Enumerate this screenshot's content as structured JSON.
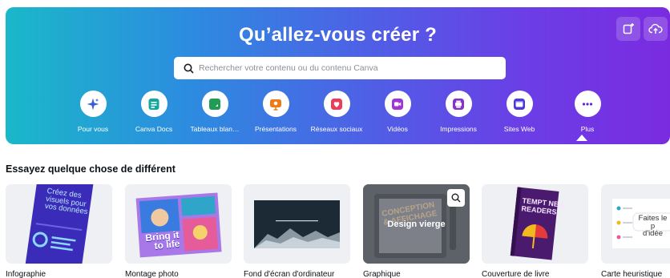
{
  "hero": {
    "title": "Qu’allez-vous créer ?",
    "search_placeholder": "Rechercher votre contenu ou du contenu Canva",
    "gradient_colors": [
      "#1ab8c9",
      "#4f5fe6",
      "#7a2be0"
    ]
  },
  "categories": [
    {
      "label": "Pour vous",
      "icon": "sparkle-icon",
      "color": "#3b5bdb"
    },
    {
      "label": "Canva Docs",
      "icon": "doc-icon",
      "color": "#13a89e"
    },
    {
      "label": "Tableaux blan…",
      "icon": "whiteboard-icon",
      "color": "#1f9d55"
    },
    {
      "label": "Présentations",
      "icon": "presentation-icon",
      "color": "#f07b16"
    },
    {
      "label": "Réseaux sociaux",
      "icon": "heart-icon",
      "color": "#ee3b5a"
    },
    {
      "label": "Vidéos",
      "icon": "video-icon",
      "color": "#a034d6"
    },
    {
      "label": "Impressions",
      "icon": "printer-icon",
      "color": "#8b2fc9"
    },
    {
      "label": "Sites Web",
      "icon": "website-icon",
      "color": "#4c3ae0"
    },
    {
      "label": "Plus",
      "icon": "more-icon",
      "color": "#5b2bd6"
    }
  ],
  "section": {
    "title": "Essayez quelque chose de différent"
  },
  "cards": [
    {
      "label": "Infographie",
      "thumb_text_lines": [
        "Créez des",
        "visuels pour",
        "vos données"
      ]
    },
    {
      "label": "Montage photo",
      "thumb_text_lines": [
        "Bring it",
        "to life"
      ]
    },
    {
      "label": "Fond d'écran d'ordinateur"
    },
    {
      "label": "Graphique",
      "hover_text": "Design vierge",
      "thumb_text_lines": [
        "CONCEPTION",
        "& AFFICHAGE"
      ]
    },
    {
      "label": "Couverture de livre",
      "thumb_text_lines": [
        "TEMPT NEW",
        "READERS"
      ]
    },
    {
      "label": "Carte heuristique",
      "thumb_text_lines": [
        "Faites le p",
        "d'idée"
      ]
    }
  ]
}
